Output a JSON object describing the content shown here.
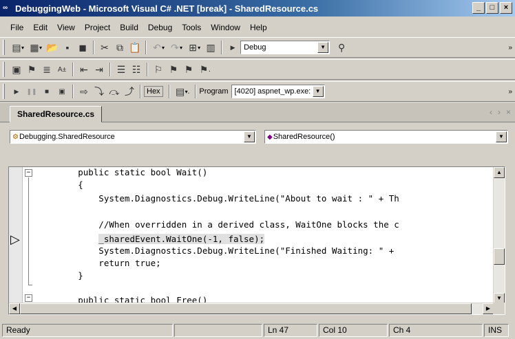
{
  "window": {
    "icon": "vs-icon",
    "title": "DebuggingWeb - Microsoft Visual C# .NET [break] - SharedResource.cs",
    "minimize": "_",
    "maximize": "□",
    "close": "×"
  },
  "menu": [
    "File",
    "Edit",
    "View",
    "Project",
    "Build",
    "Debug",
    "Tools",
    "Window",
    "Help"
  ],
  "toolbar1": {
    "config_value": "Debug"
  },
  "toolbar3": {
    "hex_label": "Hex",
    "program_label": "Program",
    "program_value": "[4020] aspnet_wp.exe:"
  },
  "tabs": {
    "active": "SharedResource.cs",
    "nav": [
      "‹",
      "›",
      "×"
    ]
  },
  "nav": {
    "class_combo": "Debugging.SharedResource",
    "member_combo": "SharedResource()"
  },
  "code": {
    "lines": [
      "        public static bool Wait()",
      "        {",
      "            System.Diagnostics.Debug.WriteLine(\"About to wait : \" + Th",
      "",
      "            //When overridden in a derived class, WaitOne blocks the c",
      "            _sharedEvent.WaitOne(-1, false);",
      "            System.Diagnostics.Debug.WriteLine(\"Finished Waiting: \" +",
      "            return true;",
      "        }",
      "",
      "        public static bool Free()"
    ]
  },
  "status": {
    "message": "Ready",
    "line": "Ln 47",
    "col": "Col 10",
    "ch": "Ch 4",
    "mode": "INS"
  },
  "icons": [
    "vs-icon",
    "new-project-icon",
    "add-item-icon",
    "open-icon",
    "save-icon",
    "save-all-icon",
    "cut-icon",
    "copy-icon",
    "paste-icon",
    "undo-icon",
    "redo-icon",
    "solution-explorer-icon",
    "start-icon",
    "find-icon",
    "continue-icon",
    "break-icon",
    "stop-icon",
    "restart-icon",
    "step-icon",
    "execution-pointer-icon"
  ]
}
